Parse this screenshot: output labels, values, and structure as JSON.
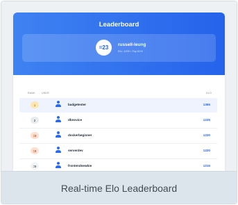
{
  "header": {
    "title": "Leaderboard",
    "current_user": {
      "rank": "=23",
      "name": "russell-leung",
      "subtitle": "Elo: 1200 • Top 61%"
    }
  },
  "table": {
    "columns": {
      "rank": "RANK",
      "user": "USER",
      "elo": "ELO"
    },
    "rows": [
      {
        "rank": "1",
        "user": "badgetester",
        "elo": "1365",
        "badge_bg": "#fde8b3",
        "badge_fg": "#b7791f",
        "highlight": true
      },
      {
        "rank": "2",
        "user": "dbnovice",
        "elo": "1225",
        "badge_bg": "#e9ecef",
        "badge_fg": "#4a5563",
        "highlight": false
      },
      {
        "rank": "=3",
        "user": "dockerbeginner",
        "elo": "1220",
        "badge_bg": "#fde0d2",
        "badge_fg": "#c2410c",
        "highlight": false
      },
      {
        "rank": "=3",
        "user": "serverdev",
        "elo": "1220",
        "badge_bg": "#fde0d2",
        "badge_fg": "#c2410c",
        "highlight": false
      },
      {
        "rank": "=5",
        "user": "frontendnewbie",
        "elo": "1215",
        "badge_bg": "#f1f3f5",
        "badge_fg": "#4a5563",
        "highlight": false
      }
    ]
  },
  "caption": "Real-time Elo Leaderboard",
  "colors": {
    "accent": "#2563eb",
    "header_gradient_start": "#3f82f2"
  },
  "icons": {
    "avatar": "user-icon"
  }
}
